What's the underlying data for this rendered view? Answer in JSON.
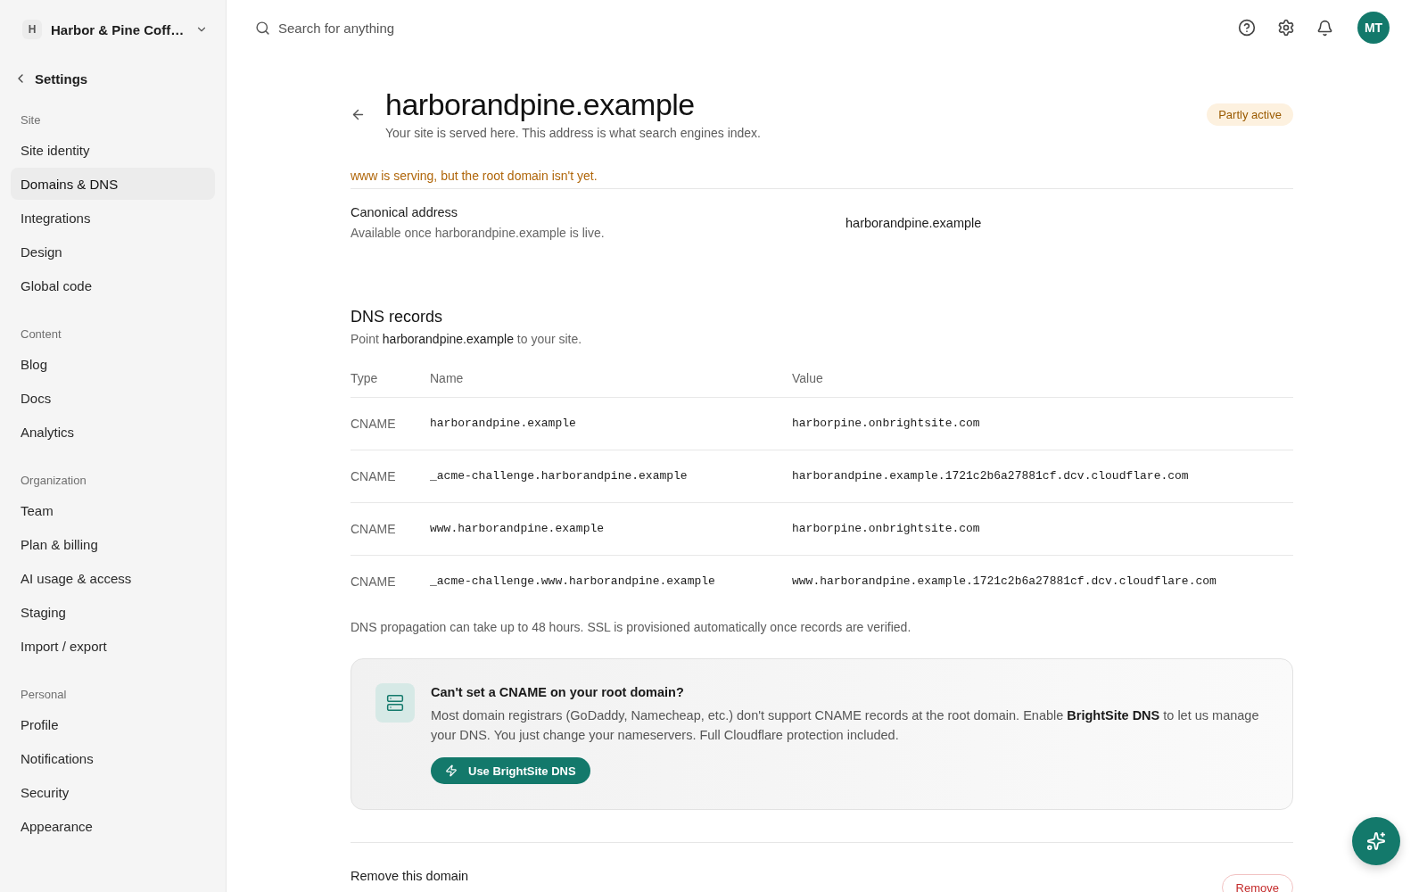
{
  "workspace": {
    "initial": "H",
    "name": "Harbor & Pine Coff…"
  },
  "sidebar": {
    "back_label": "Settings",
    "sections": [
      {
        "label": "Site",
        "items": [
          {
            "label": "Site identity",
            "selected": false
          },
          {
            "label": "Domains & DNS",
            "selected": true
          },
          {
            "label": "Integrations",
            "selected": false
          },
          {
            "label": "Design",
            "selected": false
          },
          {
            "label": "Global code",
            "selected": false
          }
        ]
      },
      {
        "label": "Content",
        "items": [
          {
            "label": "Blog",
            "selected": false
          },
          {
            "label": "Docs",
            "selected": false
          },
          {
            "label": "Analytics",
            "selected": false
          }
        ]
      },
      {
        "label": "Organization",
        "items": [
          {
            "label": "Team",
            "selected": false
          },
          {
            "label": "Plan & billing",
            "selected": false
          },
          {
            "label": "AI usage & access",
            "selected": false
          },
          {
            "label": "Staging",
            "selected": false
          },
          {
            "label": "Import / export",
            "selected": false
          }
        ]
      },
      {
        "label": "Personal",
        "items": [
          {
            "label": "Profile",
            "selected": false
          },
          {
            "label": "Notifications",
            "selected": false
          },
          {
            "label": "Security",
            "selected": false
          },
          {
            "label": "Appearance",
            "selected": false
          }
        ]
      }
    ]
  },
  "topbar": {
    "search": {
      "placeholder": "Search for anything"
    },
    "avatar": {
      "initials": "MT"
    }
  },
  "header": {
    "title": "harborandpine.example",
    "subtitle": "Your site is served here. This address is what search engines index.",
    "status_badge": "Partly active"
  },
  "warning": "www is serving, but the root domain isn't yet.",
  "canonical": {
    "label": "Canonical address",
    "description": "Available once harborandpine.example is live.",
    "value": "harborandpine.example"
  },
  "dns": {
    "title": "DNS records",
    "description": "Point **harborandpine.example** to your site.",
    "columns": [
      "Type",
      "Name",
      "Value"
    ],
    "records": [
      {
        "type": "CNAME",
        "name": "harborandpine.example",
        "value": "harborpine.onbrightsite.com"
      },
      {
        "type": "CNAME",
        "name": "_acme-challenge.harborandpine.example",
        "value": "harborandpine.example.1721c2b6a27881cf.dcv.cloudflare.com"
      },
      {
        "type": "CNAME",
        "name": "www.harborandpine.example",
        "value": "harborpine.onbrightsite.com"
      },
      {
        "type": "CNAME",
        "name": "_acme-challenge.www.harborandpine.example",
        "value": "www.harborandpine.example.1721c2b6a27881cf.dcv.cloudflare.com"
      }
    ],
    "note": "DNS propagation can take up to 48 hours. SSL is provisioned automatically once records are verified."
  },
  "callout": {
    "title": "Can't set a CNAME on your root domain?",
    "body": "Most domain registrars (GoDaddy, Namecheap, etc.) don't support CNAME records at the root domain. Enable **BrightSite DNS** to let us manage your DNS. You just change your nameservers. Full Cloudflare protection included.",
    "button": "Use BrightSite DNS"
  },
  "danger": {
    "title": "Remove this domain",
    "button": "Remove"
  }
}
